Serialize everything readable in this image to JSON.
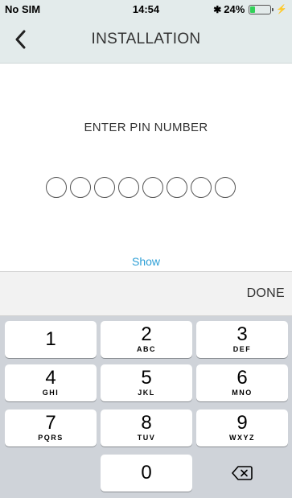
{
  "status_bar": {
    "carrier": "No SIM",
    "time": "14:54",
    "bluetooth": "✱",
    "battery_percent": "24%",
    "battery_level": 0.24,
    "charging_icon": "⚡"
  },
  "nav": {
    "title": "INSTALLATION",
    "back_icon": "chevron-left-icon"
  },
  "pin": {
    "label": "ENTER PIN NUMBER",
    "digits_total": 8,
    "digits_filled": 0,
    "show_label": "Show"
  },
  "accessory": {
    "done_label": "DONE"
  },
  "keypad": {
    "keys": [
      {
        "digit": "1",
        "letters": ""
      },
      {
        "digit": "2",
        "letters": "ABC"
      },
      {
        "digit": "3",
        "letters": "DEF"
      },
      {
        "digit": "4",
        "letters": "GHI"
      },
      {
        "digit": "5",
        "letters": "JKL"
      },
      {
        "digit": "6",
        "letters": "MNO"
      },
      {
        "digit": "7",
        "letters": "PQRS"
      },
      {
        "digit": "8",
        "letters": "TUV"
      },
      {
        "digit": "9",
        "letters": "WXYZ"
      },
      {
        "digit": "0",
        "letters": ""
      }
    ],
    "delete_icon": "backspace-icon"
  },
  "colors": {
    "header_bg": "#e3ebeb",
    "link": "#2d9fd6",
    "keypad_bg": "#cfd3d9",
    "battery": "#31d159"
  }
}
